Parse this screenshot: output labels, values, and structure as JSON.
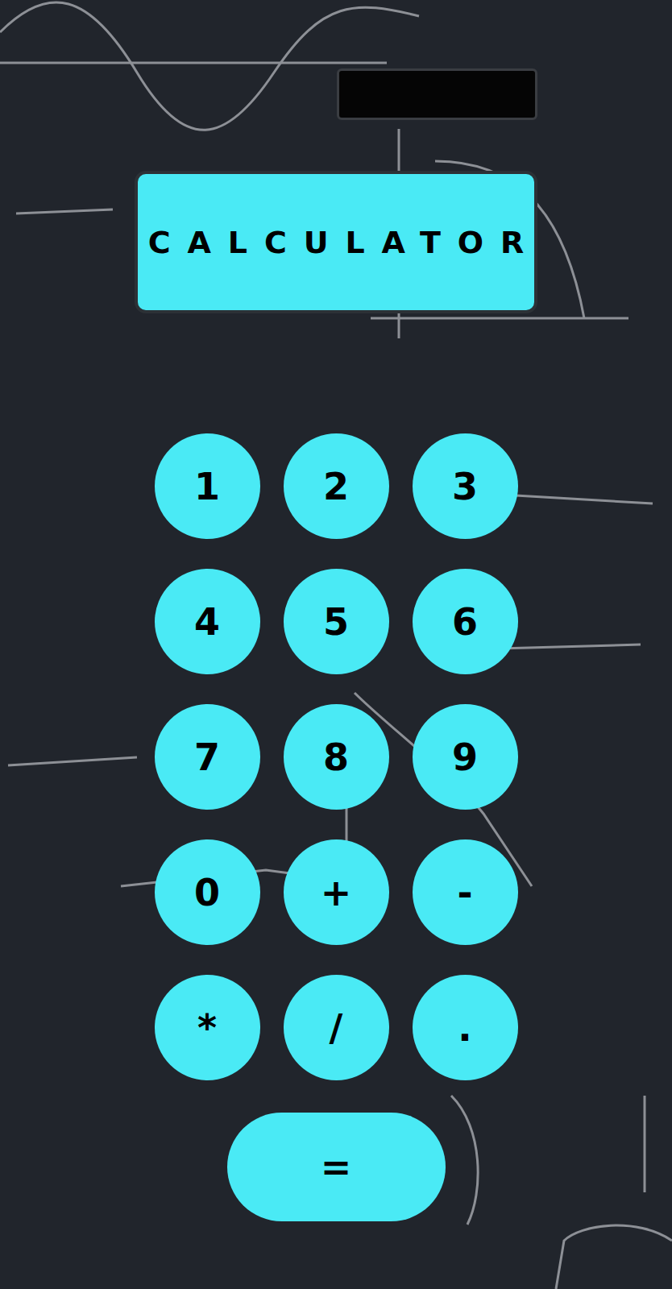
{
  "title": "CALCULATOR",
  "display": {
    "value": ""
  },
  "keys": [
    "1",
    "2",
    "3",
    "4",
    "5",
    "6",
    "7",
    "8",
    "9",
    "0",
    "+",
    "-",
    "*",
    "/",
    "."
  ],
  "equals": "="
}
